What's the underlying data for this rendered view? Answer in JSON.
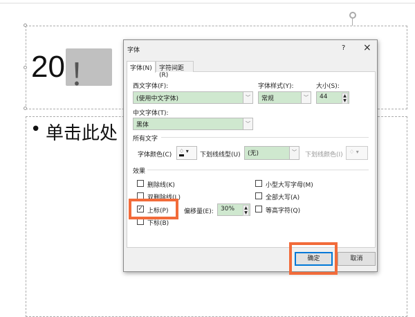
{
  "slide": {
    "title_text": "20",
    "title_highlight": "！",
    "body_bullet": "•",
    "body_text": "单击此处"
  },
  "dialog": {
    "title": "字体",
    "help": "?",
    "close": "×",
    "tabs": [
      {
        "label": "字体(N)",
        "active": true
      },
      {
        "label": "字符间距(R)",
        "active": false
      }
    ],
    "latin_font_label": "西文字体(F):",
    "latin_font_value": "(使用中文字体)",
    "style_label": "字体样式(Y):",
    "style_value": "常规",
    "size_label": "大小(S):",
    "size_value": "44",
    "cjk_font_label": "中文字体(T):",
    "cjk_font_value": "黑体",
    "all_text_heading": "所有文字",
    "font_color_label": "字体颜色(C)",
    "underline_style_label": "下划线线型(U)",
    "underline_style_value": "(无)",
    "underline_color_label": "下划线颜色(I)",
    "effects_heading": "效果",
    "effects_left": [
      {
        "label": "删除线(K)",
        "checked": false
      },
      {
        "label": "双删除线(L)",
        "checked": false
      },
      {
        "label": "上标(P)",
        "checked": true
      },
      {
        "label": "下标(B)",
        "checked": false
      }
    ],
    "effects_right": [
      {
        "label": "小型大写字母(M)",
        "checked": false
      },
      {
        "label": "全部大写(A)",
        "checked": false
      },
      {
        "label": "等高字符(Q)",
        "checked": false
      }
    ],
    "offset_label": "偏移量(E):",
    "offset_value": "30%",
    "ok_label": "确定",
    "cancel_label": "取消"
  },
  "colors": {
    "highlight": "#f26b3a",
    "field": "#cfe8cf",
    "accent": "#0078d7"
  }
}
